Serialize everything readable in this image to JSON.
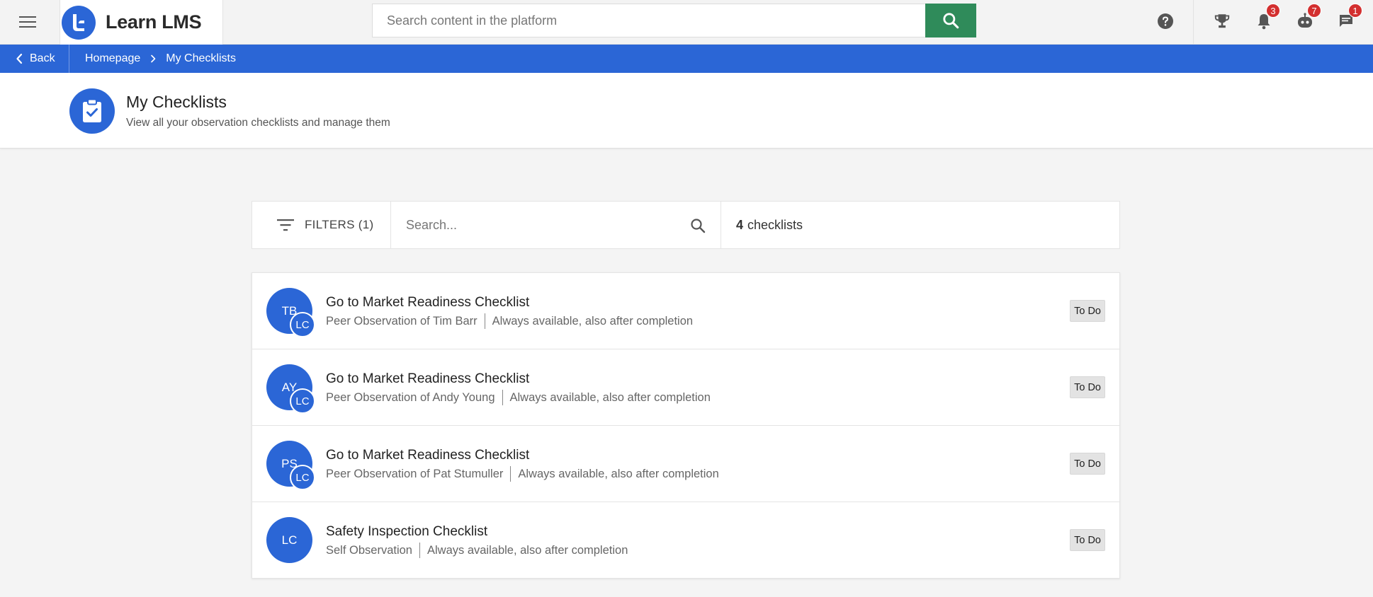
{
  "app": {
    "name": "Learn LMS",
    "colors": {
      "primary": "#2b66d6",
      "search_button": "#2f8b5a",
      "badge": "#d32f2f"
    }
  },
  "topbar": {
    "search_placeholder": "Search content in the platform",
    "icons": {
      "menu": "hamburger-menu-icon",
      "help": "help-icon",
      "trophy": "trophy-icon",
      "notifications": "bell-icon",
      "assistant": "robot-icon",
      "messages": "chat-icon"
    },
    "badges": {
      "notifications": "3",
      "assistant": "7",
      "messages": "1"
    }
  },
  "breadcrumb": {
    "back_label": "Back",
    "items": [
      "Homepage",
      "My Checklists"
    ]
  },
  "page": {
    "title": "My Checklists",
    "subtitle": "View all your observation checklists and manage them"
  },
  "toolbar": {
    "filters_label": "FILTERS (1)",
    "search_placeholder": "Search...",
    "count_number": "4",
    "count_label": "checklists"
  },
  "checklists": [
    {
      "avatar": "TB",
      "sub_avatar": "LC",
      "title": "Go to Market Readiness Checklist",
      "subject": "Peer Observation of Tim Barr",
      "availability": "Always available, also after completion",
      "status": "To Do"
    },
    {
      "avatar": "AY",
      "sub_avatar": "LC",
      "title": "Go to Market Readiness Checklist",
      "subject": "Peer Observation of Andy Young",
      "availability": "Always available, also after completion",
      "status": "To Do"
    },
    {
      "avatar": "PS",
      "sub_avatar": "LC",
      "title": "Go to Market Readiness Checklist",
      "subject": "Peer Observation of Pat Stumuller",
      "availability": "Always available, also after completion",
      "status": "To Do"
    },
    {
      "avatar": "LC",
      "sub_avatar": "",
      "title": "Safety Inspection Checklist",
      "subject": "Self Observation",
      "availability": "Always available, also after completion",
      "status": "To Do"
    }
  ]
}
